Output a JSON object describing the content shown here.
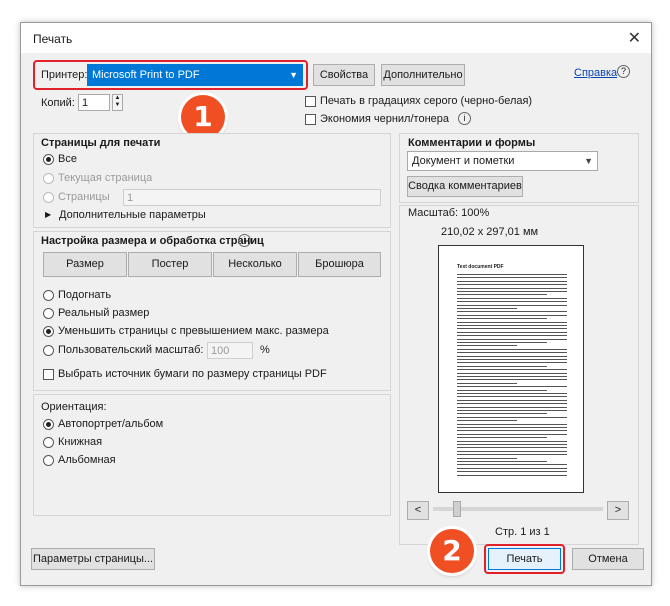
{
  "window": {
    "title": "Печать",
    "close_glyph": "✕"
  },
  "printer": {
    "label": "Принтер:",
    "selected": "Microsoft Print to PDF",
    "properties_button": "Свойства",
    "advanced_button": "Дополнительно",
    "help_link": "Справка",
    "help_glyph": "?"
  },
  "copies": {
    "label": "Копий:",
    "value": "1"
  },
  "options": {
    "grayscale": "Печать в градациях серого (черно-белая)",
    "save_ink": "Экономия чернил/тонера",
    "info_glyph": "i"
  },
  "pages": {
    "title": "Страницы для печати",
    "all": "Все",
    "current": "Текущая страница",
    "pages_label": "Страницы",
    "pages_value": "1",
    "more_options": "Дополнительные параметры"
  },
  "sizing": {
    "title": "Настройка размера и обработка страниц",
    "tabs": [
      "Размер",
      "Постер",
      "Несколько",
      "Брошюра"
    ],
    "fit": "Подогнать",
    "actual": "Реальный размер",
    "shrink": "Уменьшить страницы с превышением макс. размера",
    "custom": "Пользовательский масштаб:",
    "custom_value": "100",
    "percent": "%",
    "paper_source": "Выбрать источник бумаги по размеру страницы PDF"
  },
  "orientation": {
    "title": "Ориентация:",
    "auto": "Автопортрет/альбом",
    "portrait": "Книжная",
    "landscape": "Альбомная"
  },
  "comments": {
    "title": "Комментарии и формы",
    "selected": "Документ и пометки",
    "summary_button": "Сводка комментариев"
  },
  "preview": {
    "scale": "Масштаб: 100%",
    "dimensions": "210,02 x 297,01 мм",
    "doc_title": "Text document PDF",
    "page_counter": "Стр. 1 из 1",
    "prev_glyph": "<",
    "next_glyph": ">"
  },
  "footer": {
    "page_setup": "Параметры страницы...",
    "print": "Печать",
    "cancel": "Отмена"
  },
  "annotations": {
    "badge1": "1",
    "badge2": "2"
  },
  "colors": {
    "highlight": "#0078d7",
    "annotation_red": "#e0202a",
    "badge_orange": "#f04e23"
  }
}
